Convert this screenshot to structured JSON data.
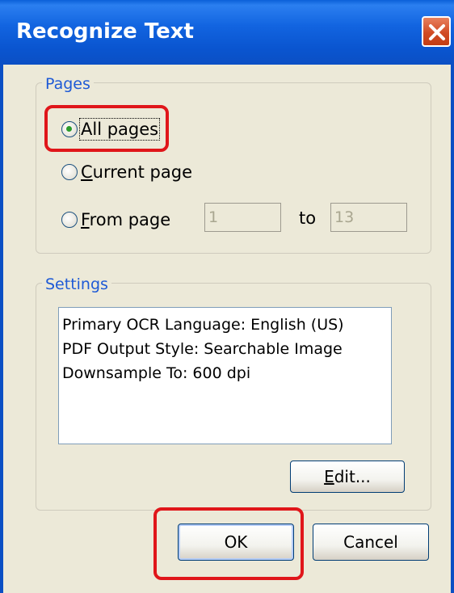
{
  "window": {
    "title": "Recognize Text"
  },
  "pages": {
    "legend": "Pages",
    "options": [
      {
        "label": "All pages",
        "selected": true
      },
      {
        "label": "Current page",
        "selected": false
      },
      {
        "label": "From page",
        "selected": false
      }
    ],
    "from_value": "1",
    "to_label": "to",
    "to_value": "13"
  },
  "settings": {
    "legend": "Settings",
    "lines": [
      "Primary OCR Language: English (US)",
      "PDF Output Style: Searchable Image",
      "Downsample To: 600 dpi"
    ],
    "edit_label": "Edit..."
  },
  "buttons": {
    "ok_label": "OK",
    "cancel_label": "Cancel"
  },
  "colors": {
    "titlebar": "#0b4fc4",
    "highlight": "#e0161a",
    "legend_text": "#1e5ad6"
  }
}
